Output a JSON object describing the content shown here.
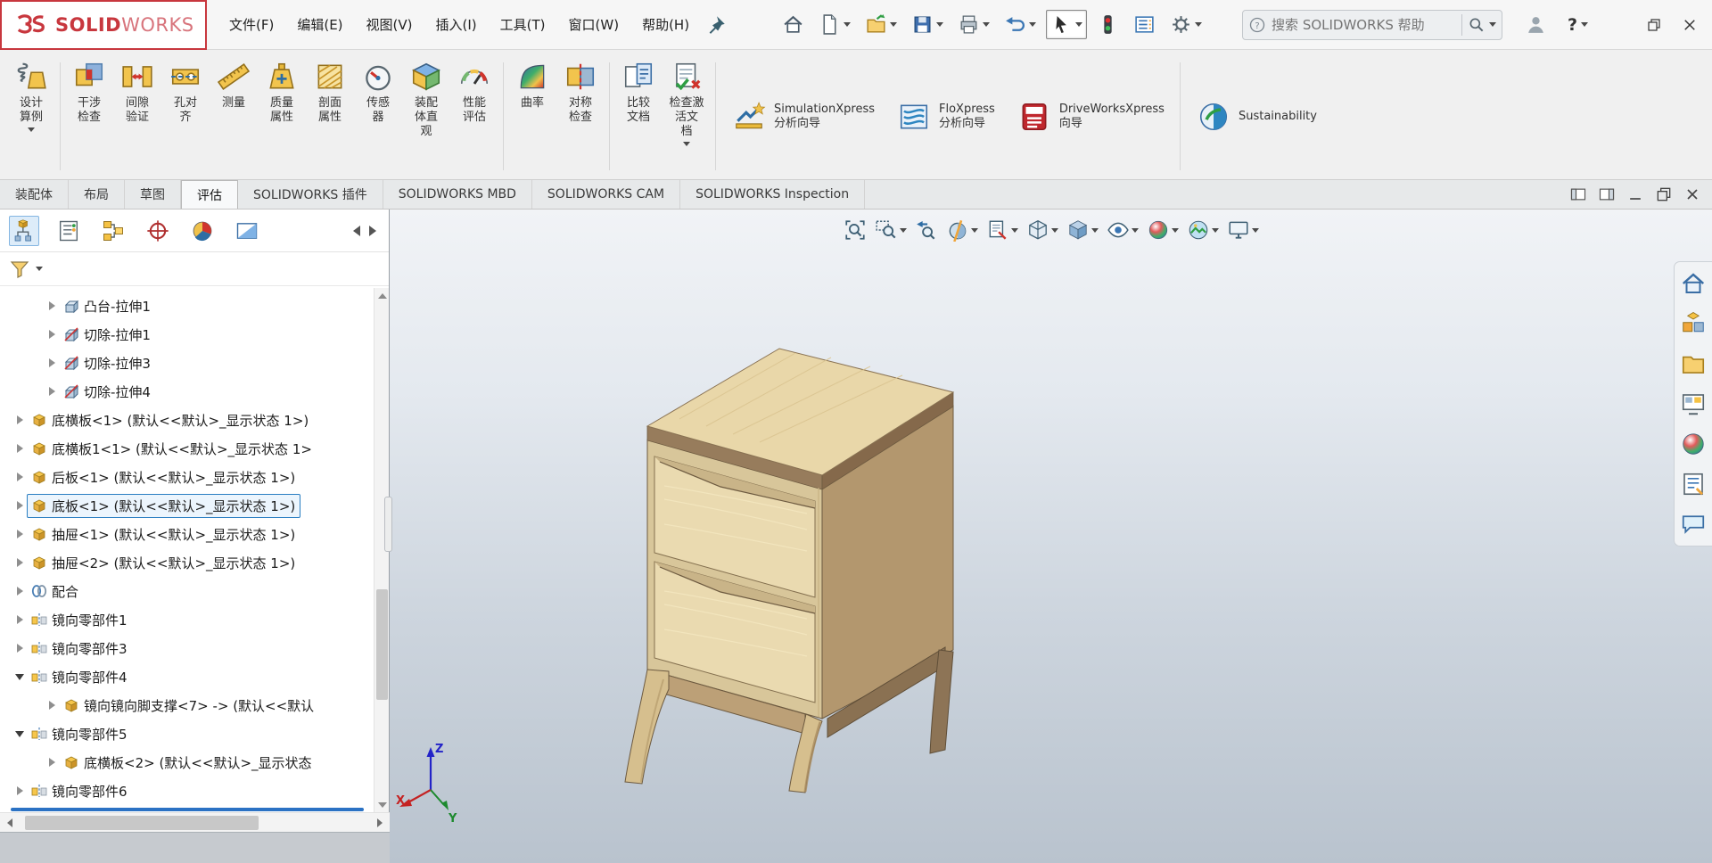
{
  "titlebar": {
    "brand_solid": "SOLID",
    "brand_works": "WORKS",
    "menus": [
      {
        "label": "文件(F)"
      },
      {
        "label": "编辑(E)"
      },
      {
        "label": "视图(V)"
      },
      {
        "label": "插入(I)"
      },
      {
        "label": "工具(T)"
      },
      {
        "label": "窗口(W)"
      },
      {
        "label": "帮助(H)"
      }
    ],
    "quick_tools": [
      "pin",
      "home",
      "new-document",
      "open",
      "save",
      "print",
      "undo",
      "select",
      "traffic-light",
      "command-list",
      "options"
    ],
    "search": {
      "placeholder": "搜索 SOLIDWORKS 帮助"
    },
    "help_label": "?"
  },
  "ribbon": {
    "items": [
      {
        "id": "design-study",
        "label": "设计\n算例",
        "dropdown": true
      },
      {
        "id": "interference-check",
        "label": "干涉\n检查"
      },
      {
        "id": "clearance-verify",
        "label": "间隙\n验证"
      },
      {
        "id": "hole-alignment",
        "label": "孔对\n齐"
      },
      {
        "id": "measure",
        "label": "测量"
      },
      {
        "id": "mass-properties",
        "label": "质量\n属性"
      },
      {
        "id": "section-properties",
        "label": "剖面\n属性"
      },
      {
        "id": "sensor",
        "label": "传感\n器"
      },
      {
        "id": "assembly-visualization",
        "label": "装配\n体直\n观"
      },
      {
        "id": "performance-evaluation",
        "label": "性能\n评估"
      },
      {
        "id": "curvature",
        "label": "曲率"
      },
      {
        "id": "symmetry-check",
        "label": "对称\n检查"
      },
      {
        "id": "compare-documents",
        "label": "比较\n文档"
      },
      {
        "id": "check-active-document",
        "label": "检查激\n活文\n档",
        "dropdown": true
      },
      {
        "id": "simulationxpress",
        "label": "SimulationXpress\n分析向导"
      },
      {
        "id": "floxpress",
        "label": "FloXpress\n分析向导"
      },
      {
        "id": "driveworksxpress",
        "label": "DriveWorksXpress\n向导"
      },
      {
        "id": "sustainability",
        "label": "Sustainability"
      }
    ]
  },
  "command_tabs": {
    "active_index": 3,
    "items": [
      {
        "label": "装配体"
      },
      {
        "label": "布局"
      },
      {
        "label": "草图"
      },
      {
        "label": "评估"
      },
      {
        "label": "SOLIDWORKS 插件"
      },
      {
        "label": "SOLIDWORKS MBD"
      },
      {
        "label": "SOLIDWORKS CAM"
      },
      {
        "label": "SOLIDWORKS Inspection"
      }
    ]
  },
  "manager_panel": {
    "tabs": [
      "featuremanager-design-tree",
      "propertymanager",
      "configurationmanager",
      "dimxpertmanager",
      "displaymanager",
      "cam-feature-tree"
    ],
    "tree": {
      "items": [
        {
          "icon": "boss-extrude",
          "label": "凸台-拉伸1",
          "level": 1,
          "state": "collapsed"
        },
        {
          "icon": "cut-extrude",
          "label": "切除-拉伸1",
          "level": 1,
          "state": "collapsed"
        },
        {
          "icon": "cut-extrude",
          "label": "切除-拉伸3",
          "level": 1,
          "state": "collapsed"
        },
        {
          "icon": "cut-extrude",
          "label": "切除-拉伸4",
          "level": 1,
          "state": "collapsed"
        },
        {
          "icon": "part",
          "label": "底横板<1> (默认<<默认>_显示状态 1>)",
          "level": 0,
          "state": "collapsed"
        },
        {
          "icon": "part",
          "label": "底横板1<1> (默认<<默认>_显示状态 1>",
          "level": 0,
          "state": "collapsed"
        },
        {
          "icon": "part",
          "label": "后板<1> (默认<<默认>_显示状态 1>)",
          "level": 0,
          "state": "collapsed"
        },
        {
          "icon": "part",
          "label": "底板<1> (默认<<默认>_显示状态 1>)",
          "level": 0,
          "state": "collapsed",
          "selected": true
        },
        {
          "icon": "part",
          "label": "抽屉<1> (默认<<默认>_显示状态 1>)",
          "level": 0,
          "state": "collapsed"
        },
        {
          "icon": "part",
          "label": "抽屉<2> (默认<<默认>_显示状态 1>)",
          "level": 0,
          "state": "collapsed"
        },
        {
          "icon": "mates",
          "label": "配合",
          "level": 0,
          "state": "collapsed"
        },
        {
          "icon": "mirror-component",
          "label": "镜向零部件1",
          "level": 0,
          "state": "collapsed"
        },
        {
          "icon": "mirror-component",
          "label": "镜向零部件3",
          "level": 0,
          "state": "collapsed"
        },
        {
          "icon": "mirror-component",
          "label": "镜向零部件4",
          "level": 0,
          "state": "expanded"
        },
        {
          "icon": "part",
          "label": "镜向镜向脚支撑<7> -> (默认<<默认",
          "level": 1,
          "state": "collapsed"
        },
        {
          "icon": "mirror-component",
          "label": "镜向零部件5",
          "level": 0,
          "state": "expanded"
        },
        {
          "icon": "part",
          "label": "底横板<2> (默认<<默认>_显示状态",
          "level": 1,
          "state": "collapsed"
        },
        {
          "icon": "mirror-component",
          "label": "镜向零部件6",
          "level": 0,
          "state": "collapsed"
        }
      ]
    }
  },
  "viewport": {
    "headsup_tools": [
      "zoom-to-fit",
      "zoom-to-area",
      "previous-view",
      "section-view",
      "dynamic-annotation-views",
      "view-orientation",
      "display-style",
      "hide-show-items",
      "edit-appearance",
      "apply-scene",
      "view-settings"
    ],
    "triad": {
      "x": "X",
      "y": "Y",
      "z": "Z"
    }
  },
  "task_pane": {
    "tabs": [
      "solidworks-resources",
      "design-library",
      "file-explorer",
      "view-palette",
      "appearances-scenes",
      "custom-properties",
      "solidworks-forum"
    ]
  },
  "colors": {
    "brand_red": "#c8373e",
    "selection_outline": "#2a7ec2",
    "rollback_bar": "#2b72c4",
    "viewport_gradient_top": "#f1f3f6",
    "viewport_gradient_bottom": "#b9c3ce",
    "wood_light": "#eadab0",
    "wood_mid": "#d8c69a",
    "wood_dark": "#8d7456"
  }
}
